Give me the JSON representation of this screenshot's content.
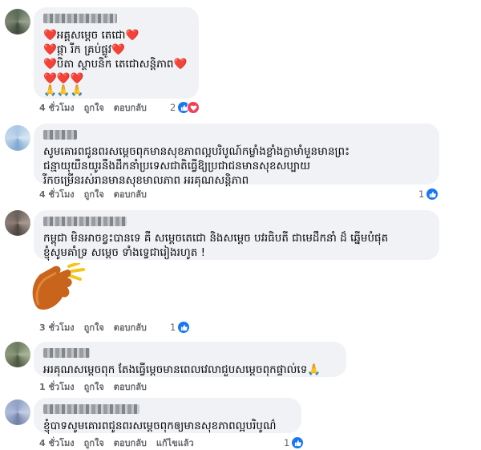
{
  "comments": [
    {
      "lines": [
        "❤️អគ្គសម្តេច តេជោ❤️",
        "❤️ផ្កា រីក គ្រប់ផ្លូវ❤️",
        "❤️បិតា ស្ថាបនិក តេជោសន្តិភាព❤️",
        "❤️❤️❤️",
        "🙏🙏🙏"
      ],
      "time": "4 ชั่วโมง",
      "like": "ถูกใจ",
      "reply": "ตอบกลับ",
      "reaction_count": "2",
      "reactions": [
        "like-icon",
        "love-icon"
      ]
    },
    {
      "lines": [
        "សូមគោរពជូនពរសម្តេចពុកមានសុខភាពល្អបរិបូណ៍កម្លាំងខ្លាំងក្លាមាំមួនមានព្រះ",
        "ជន្មាយុយឺនយូរនឹងដឹកនាំប្រទេសជាតិធ្វើឱ្យប្រជាជនមានសុខសប្បាយ",
        "រីកចម្រើនរស់រាន​មានសុខមាលភាព អរគុណសន្តិភាព"
      ],
      "time": "4 ชั่วโมง",
      "like": "ถูกใจ",
      "reply": "ตอบกลับ",
      "reaction_count": "1",
      "reactions": [
        "like-icon"
      ]
    },
    {
      "lines": [
        "កម្ពុជា មិនអាចខ្វះបានទេ គឺ សម្តេចតេជោ និងសម្តេច បវរធិបតី ជាមេដឹកនាំ ដ៏ ឆ្នើមបំផុត",
        "ខ្ញុំសូមគាំទ្រ សម្តេច ទាំងទ្វេជារៀងរហូត !"
      ],
      "sticker": "clapping-hands-sticker",
      "time": "3 ชั่วโมง",
      "like": "ถูกใจ",
      "reply": "ตอบกลับ",
      "reaction_count": "1",
      "reactions": [
        "like-icon"
      ]
    },
    {
      "lines": [
        "អរគុណសម្តេចពុក តែង​ធ្វើម្តេចមានពេលវេលាជួបសម្តេចពុកផ្ទាល់ទេ🙏"
      ],
      "time": "1 ชั่วโมง",
      "like": "ถูกใจ",
      "reply": "ตอบกลับ",
      "reaction_count": "",
      "reactions": []
    },
    {
      "lines": [
        "ខ្ញុំបាទសូមគោរពជូនពរសម្តេចពុកឲ្យមានសុខភាពល្អបរិបូណ៌"
      ],
      "time": "4 ชั่วโมง",
      "like": "ถูกใจ",
      "reply": "ตอบกลับ",
      "extra": "แก้ไขแล้ว",
      "reaction_count": "1",
      "reactions": [
        "like-icon"
      ]
    }
  ],
  "colors": {
    "bubble": "#f0f2f5",
    "meta": "#65676b",
    "like": "#1877f2",
    "love": "#f33e58"
  }
}
